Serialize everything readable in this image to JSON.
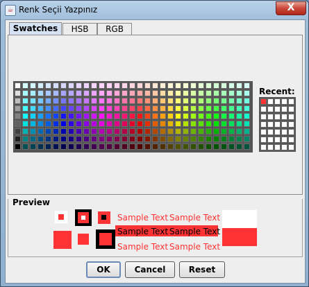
{
  "window": {
    "title": "Renk Seçii Yazpınız",
    "close_label": "X"
  },
  "tabs": [
    {
      "label": "Swatches",
      "active": true
    },
    {
      "label": "HSB",
      "active": false
    },
    {
      "label": "RGB",
      "active": false
    }
  ],
  "swatches": {
    "recent_label": "Recent:",
    "recent_color": "#ff3333"
  },
  "preview": {
    "label": "Preview",
    "sample_text": "Sample Text",
    "text_color": "#ff3333",
    "highlight_bg": "#ff3333"
  },
  "buttons": {
    "ok": "OK",
    "cancel": "Cancel",
    "reset": "Reset"
  }
}
